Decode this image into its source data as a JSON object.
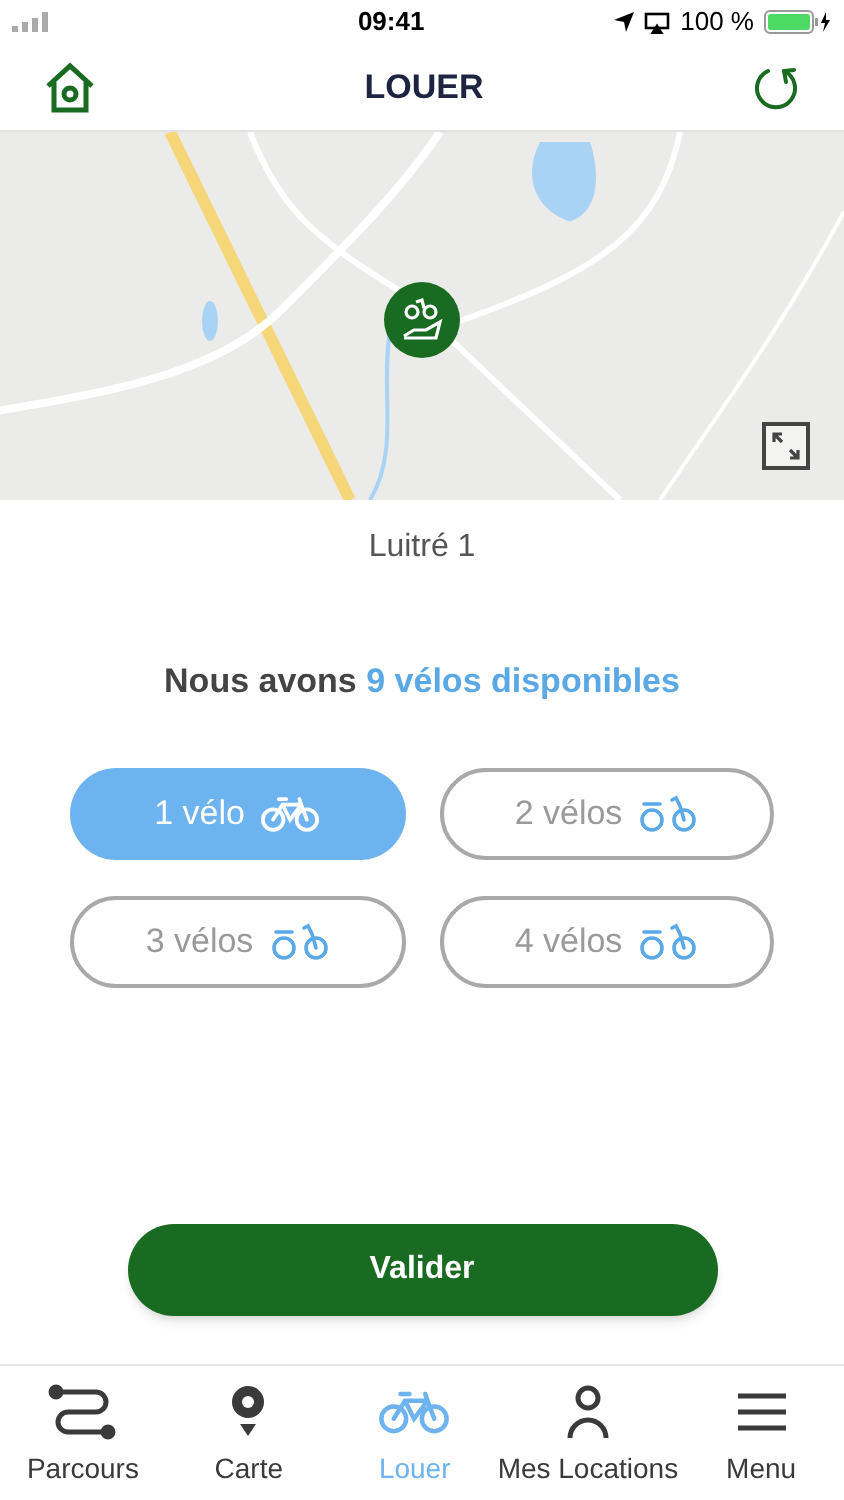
{
  "status_bar": {
    "time": "09:41",
    "battery": "100 %"
  },
  "header": {
    "title": "LOUER"
  },
  "station": "Luitré 1",
  "availability": {
    "prefix": "Nous avons",
    "highlight": "9 vélos disponibles"
  },
  "options": [
    {
      "label": "1 vélo",
      "selected": true
    },
    {
      "label": "2 vélos",
      "selected": false
    },
    {
      "label": "3 vélos",
      "selected": false
    },
    {
      "label": "4 vélos",
      "selected": false
    }
  ],
  "validate_button": "Valider",
  "tabs": [
    {
      "label": "Parcours",
      "kind": "route",
      "selected": false
    },
    {
      "label": "Carte",
      "kind": "pin",
      "selected": false
    },
    {
      "label": "Louer",
      "kind": "bike",
      "selected": true
    },
    {
      "label": "Mes Locations",
      "kind": "person",
      "selected": false
    },
    {
      "label": "Menu",
      "kind": "menu",
      "selected": false
    }
  ]
}
